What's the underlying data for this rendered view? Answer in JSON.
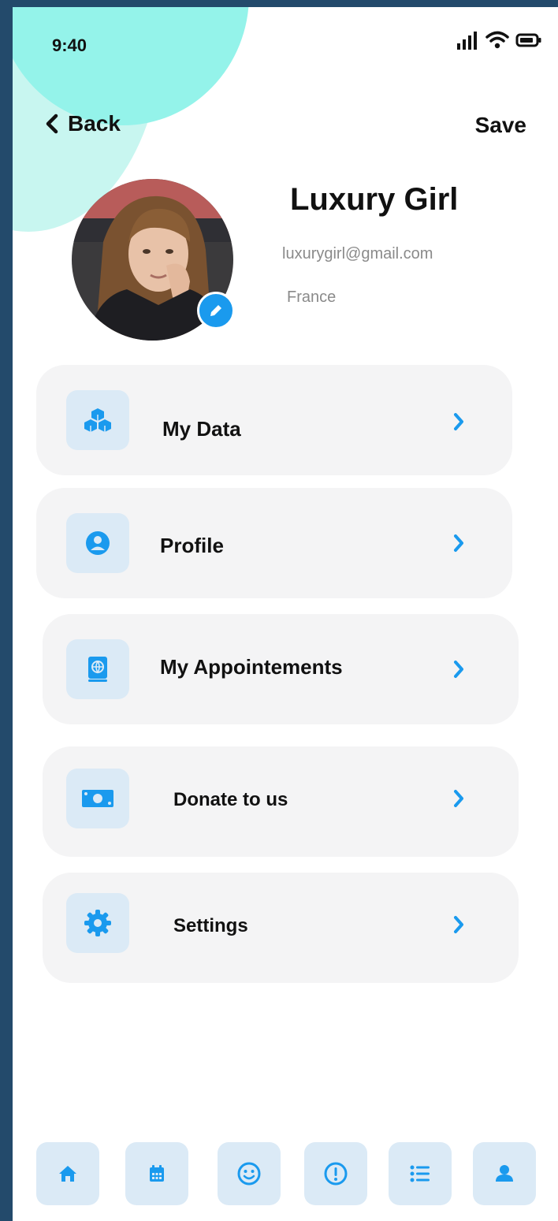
{
  "status": {
    "time": "9:40"
  },
  "header": {
    "back_label": "Back",
    "save_label": "Save"
  },
  "profile": {
    "name": "Luxury Girl",
    "email": "luxurygirl@gmail.com",
    "country": "France"
  },
  "menu": [
    {
      "label": "My Data",
      "icon": "cubes-icon"
    },
    {
      "label": "Profile",
      "icon": "user-circle-icon"
    },
    {
      "label": "My Appointements",
      "icon": "globe-book-icon"
    },
    {
      "label": "Donate to us",
      "icon": "money-bill-icon"
    },
    {
      "label": "Settings",
      "icon": "gear-icon"
    }
  ],
  "bottom_nav": [
    {
      "icon": "home-icon"
    },
    {
      "icon": "calendar-icon"
    },
    {
      "icon": "smiley-icon"
    },
    {
      "icon": "alert-icon"
    },
    {
      "icon": "list-icon"
    },
    {
      "icon": "user-icon",
      "active": true
    }
  ],
  "colors": {
    "accent": "#1a9aee",
    "card": "#f4f4f5",
    "icon_bg": "#dbeaf6",
    "blob_light": "#c8f6f0",
    "blob_dark": "#94f3ea",
    "frame": "#234a6b"
  }
}
